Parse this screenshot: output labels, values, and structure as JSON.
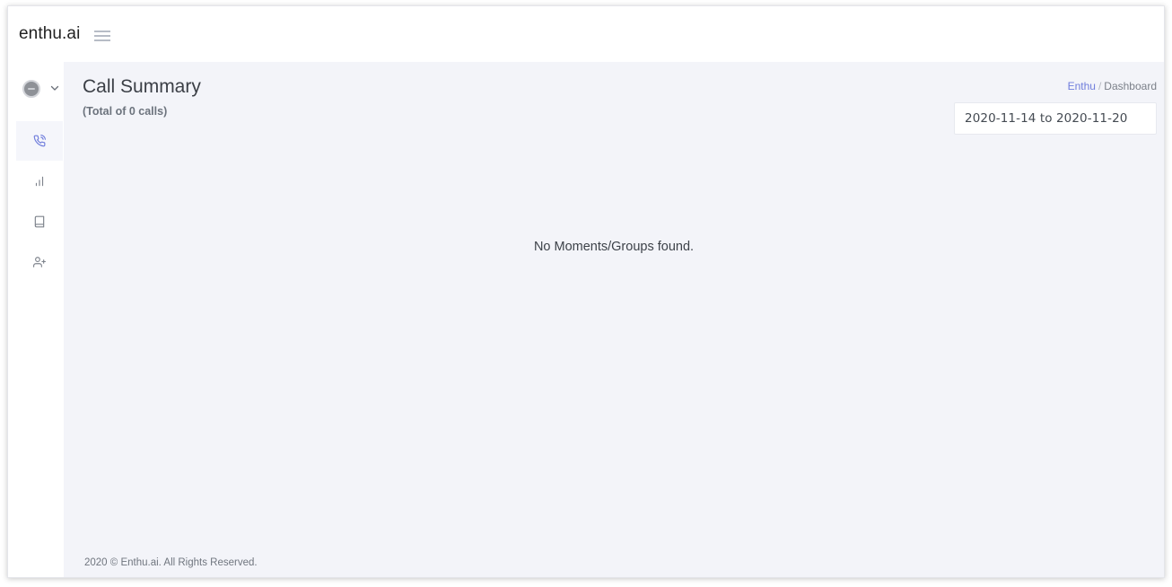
{
  "header": {
    "brand": "enthu.ai"
  },
  "sidebar": {
    "items": [
      {
        "name": "calls",
        "icon": "phone-call-icon",
        "active": true
      },
      {
        "name": "analytics",
        "icon": "bar-chart-icon",
        "active": false
      },
      {
        "name": "library",
        "icon": "book-icon",
        "active": false
      },
      {
        "name": "add-user",
        "icon": "user-plus-icon",
        "active": false
      }
    ]
  },
  "main": {
    "title": "Call Summary",
    "subtitle": "(Total of 0 calls)",
    "breadcrumb": {
      "root": "Enthu",
      "separator": "/",
      "current": "Dashboard"
    },
    "date_range": "2020-11-14 to 2020-11-20",
    "empty_message": "No Moments/Groups found.",
    "footer": "2020 © Enthu.ai. All Rights Reserved."
  },
  "colors": {
    "accent": "#6f7ddc",
    "content_bg": "#f3f4f9"
  }
}
